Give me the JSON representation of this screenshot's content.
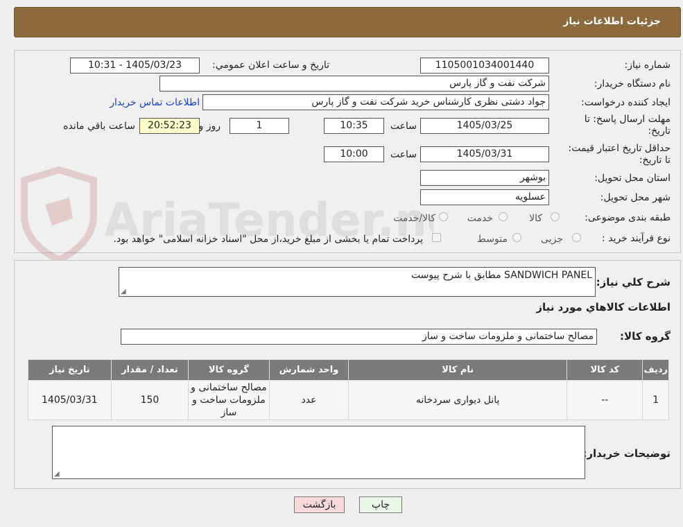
{
  "header": {
    "title": "جزئیات اطلاعات نیاز"
  },
  "form": {
    "need_number_label": "شماره نیاز:",
    "need_number": "1105001034001440",
    "announce_label": "تاریخ و ساعت اعلان عمومي:",
    "announce_value": "1405/03/23 - 10:31",
    "buyer_org_label": "نام دستگاه خریدار:",
    "buyer_org": "شرکت نفت و گاز پارس",
    "creator_label": "ایجاد کننده درخواست:",
    "creator": "جواد دشتی نظری کارشناس خرید  شرکت نفت و گاز پارس",
    "contact_link": "اطلاعات تماس خریدار",
    "deadline_label": "مهلت ارسال پاسخ: تا تاریخ:",
    "deadline_date": "1405/03/25",
    "time_label": "ساعت",
    "deadline_time": "10:35",
    "days_value": "1",
    "days_label": "روز و",
    "remaining_time": "20:52:23",
    "remaining_label": "ساعت باقي مانده",
    "validity_label": "حداقل تاریخ اعتبار قیمت: تا تاریخ:",
    "validity_date": "1405/03/31",
    "validity_time": "10:00",
    "province_label": "استان محل تحویل:",
    "province": "بوشهر",
    "city_label": "شهر محل تحویل:",
    "city": "عسلویه",
    "category_label": "طبقه بندی موضوعی:",
    "category_options": [
      "کالا",
      "خدمت",
      "کالا/خدمت"
    ],
    "process_label": "نوع فرآیند خرید :",
    "process_options": [
      "جزیی",
      "متوسط"
    ],
    "process_note": "پرداخت تمام یا بخشی از مبلغ خرید،از محل \"اسناد خزانه اسلامی\" خواهد بود."
  },
  "details": {
    "description_label": "شرح کلي نیاز:",
    "description": "SANDWICH PANEL مطابق با شرح پیوست",
    "goods_info_title": "اطلاعات کالاهاي مورد نیاز",
    "goods_group_label": "گروه کالا:",
    "goods_group": "مصالح ساختمانی و ملزومات ساخت و ساز",
    "table": {
      "headers": [
        "ردیف",
        "کد کالا",
        "نام کالا",
        "واحد شمارش",
        "گروه کالا",
        "تعداد / مقدار",
        "تاریخ نیاز"
      ],
      "rows": [
        [
          "1",
          "--",
          "پانل دیواری سردخانه",
          "عدد",
          "مصالح ساختمانی و ملزومات ساخت و ساز",
          "150",
          "1405/03/31"
        ]
      ]
    },
    "buyer_notes_label": "توضیحات خریدار:"
  },
  "buttons": {
    "print": "چاپ",
    "back": "بازگشت"
  },
  "watermark": {
    "text": "AriaTender.neT"
  },
  "colors": {
    "header_bg": "#8b6a3e",
    "table_header_bg": "#7a7a7a",
    "link": "#1a3ebd",
    "print_btn_bg": "#eaf7e6",
    "back_btn_bg": "#f9dada"
  }
}
